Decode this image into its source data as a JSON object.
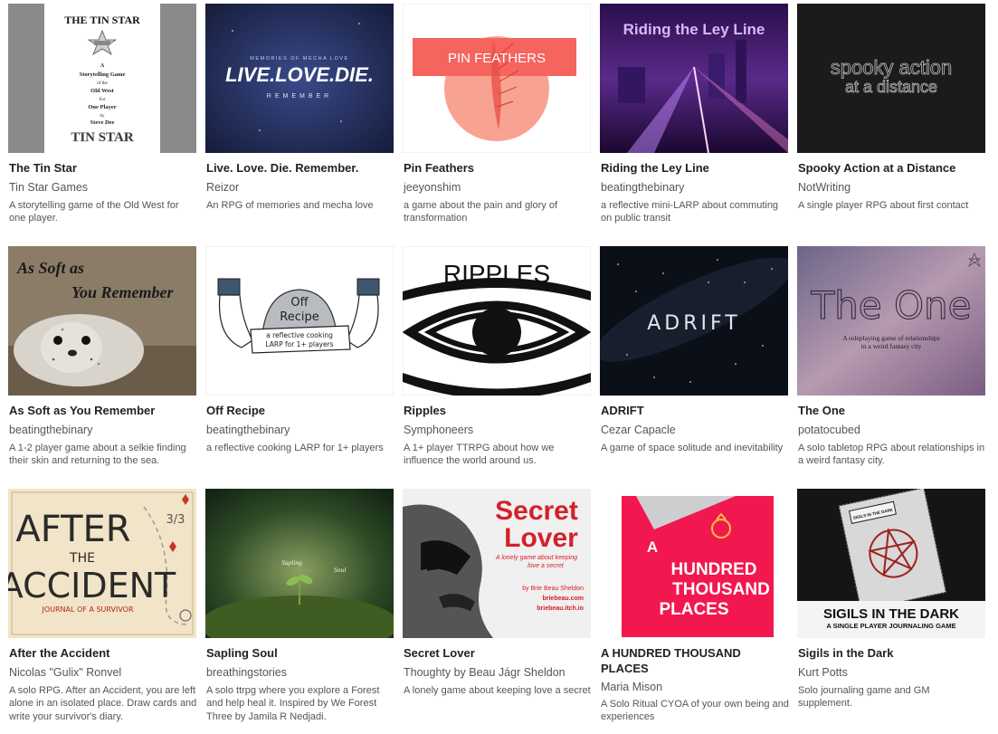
{
  "games": [
    {
      "title": "The Tin Star",
      "author": "Tin Star Games",
      "description": "A storytelling game of the Old West for one player.",
      "cover": {
        "lines": [
          "THE TIN STAR",
          "A",
          "Storytelling Game",
          "of the",
          "Old West",
          "For",
          "One Player",
          "by",
          "Steve Dee"
        ],
        "logo": "TIN STAR",
        "badge": "SHERIFF"
      }
    },
    {
      "title": "Live. Love. Die. Remember.",
      "author": "Reizor",
      "description": "An RPG of memories and mecha love",
      "cover": {
        "top": "MEMORIES OF MECHA LOVE",
        "main": "LIVE.LOVE.DIE.",
        "sub": "REMEMBER"
      }
    },
    {
      "title": "Pin Feathers",
      "author": "jeeyonshim",
      "description": "a game about the pain and glory of transformation",
      "cover": {
        "text": "PIN FEATHERS"
      }
    },
    {
      "title": "Riding the Ley Line",
      "author": "beatingthebinary",
      "description": "a reflective mini-LARP about commuting on public transit",
      "cover": {
        "text": "Riding the Ley Line"
      }
    },
    {
      "title": "Spooky Action at a Distance",
      "author": "NotWriting",
      "description": "A single player RPG about first contact",
      "cover": {
        "line1": "spooky action",
        "line2": "at a distance"
      }
    },
    {
      "title": "As Soft as You Remember",
      "author": "beatingthebinary",
      "description": "A 1-2 player game about a selkie finding their skin and returning to the sea.",
      "cover": {
        "line1": "As Soft as",
        "line2": "You Remember"
      }
    },
    {
      "title": "Off Recipe",
      "author": "beatingthebinary",
      "description": "a reflective cooking LARP for 1+ players",
      "cover": {
        "line1": "Off",
        "line2": "Recipe",
        "banner1": "a reflective cooking",
        "banner2": "LARP for 1+ players"
      }
    },
    {
      "title": "Ripples",
      "author": "Symphoneers",
      "description": "A 1+ player TTRPG about how we influence the world around us.",
      "cover": {
        "text": "RIPPLES"
      }
    },
    {
      "title": "ADRIFT",
      "author": "Cezar Capacle",
      "description": "A game of space solitude and inevitability",
      "cover": {
        "text": "ADRIFT"
      }
    },
    {
      "title": "The One",
      "author": "potatocubed",
      "description": "A solo tabletop RPG about relationships in a weird fantasy city.",
      "cover": {
        "text": "The One",
        "sub1": "A roleplaying game of relationships",
        "sub2": "in a weird fantasy city"
      }
    },
    {
      "title": "After the Accident",
      "author": "Nicolas \"Gulix\" Ronvel",
      "description": "A solo RPG. After an Accident, you are left alone in an isolated place. Draw cards and write your survivor's diary.",
      "cover": {
        "line1": "AFTER",
        "line2": "THE",
        "line3": "ACCIDENT",
        "sub": "JOURNAL OF A SURVIVOR",
        "mark": "3/3"
      }
    },
    {
      "title": "Sapling Soul",
      "author": "breathingstories",
      "description": "A solo ttrpg where you explore a Forest and help heal it. Inspired by We Forest Three by Jamila R Nedjadi.",
      "cover": {
        "word1": "Sapling",
        "word2": "Soul"
      }
    },
    {
      "title": "Secret Lover",
      "author": "Thoughty by Beau Jágr Sheldon",
      "description": "A lonely game about keeping love a secret",
      "cover": {
        "line1": "Secret",
        "line2": "Lover",
        "tag1": "A lonely game about keeping",
        "tag2": "love a secret",
        "by": "by Brie Beau Sheldon",
        "link1": "briebeau.com",
        "link2": "briebeau.itch.io"
      }
    },
    {
      "title": "A HUNDRED THOUSAND PLACES",
      "author": "Maria Mison",
      "description": "A Solo Ritual CYOA of your own being and experiences",
      "cover": {
        "lines": [
          "A",
          "HUNDRED",
          "THOUSAND",
          "PLACES"
        ]
      }
    },
    {
      "title": "Sigils in the Dark",
      "author": "Kurt Potts",
      "description": "Solo journaling game and GM supplement.",
      "cover": {
        "main": "SIGILS IN THE DARK",
        "sub": "A SINGLE PLAYER JOURNALING GAME",
        "book": "SIGILS IN THE DARK"
      }
    }
  ]
}
